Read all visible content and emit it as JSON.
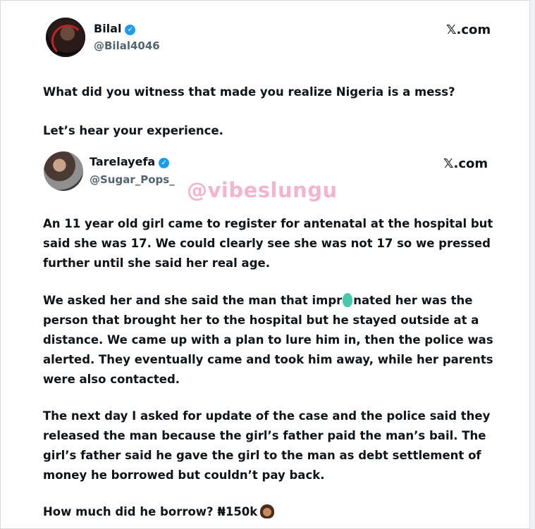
{
  "tweet": {
    "author_name": "Bilal",
    "author_handle": "@Bilal4046",
    "site": "𝕏.com",
    "lines": [
      "What did you witness that made you realize Nigeria is a mess?",
      "Let’s hear your experience."
    ]
  },
  "quoted": {
    "author_name": "Tarelayefa",
    "author_handle": "@Sugar_Pops_",
    "site": "𝕏.com",
    "watermark": "@vibeslungu",
    "p1": "An 11 year old girl came to register for antenatal at the hospital but said she was 17. We could clearly see she was not 17 so we pressed further until she said her real age.",
    "p2_before": "We asked her and she said the man that impr",
    "p2_after": "nated her was the person that brought her to the hospital but he stayed outside at a distance. We came up with a plan to lure him in, then the police was alerted. They eventually came and took him away, while her parents were also contacted.",
    "p3": "The next day I asked for update of the case and the police said they released the man because the girl’s father paid the man’s bail. The girl’s father said he gave the girl to the man as debt settlement of money he borrowed but couldn’t pay back.",
    "p4": "How much did he borrow? ₦150k"
  },
  "colors": {
    "verified": "#1d9bf0",
    "watermark": "#f2a9c5",
    "handle": "#536471",
    "blob": "#46c7b0"
  },
  "icons": [
    "verified-badge-icon",
    "person-gesturing-emoji-icon"
  ]
}
